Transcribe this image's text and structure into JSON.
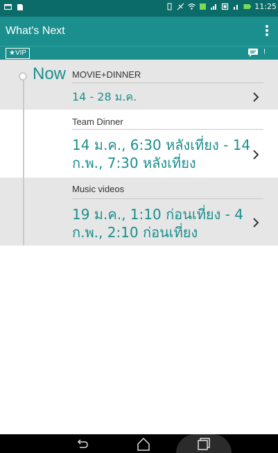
{
  "status_bar": {
    "time": "11:25"
  },
  "app_bar": {
    "title": "What's Next"
  },
  "vip_bar": {
    "badge": "★VIP",
    "alert": "!"
  },
  "timeline": {
    "now_label": "Now"
  },
  "events": [
    {
      "title": "MOVIE+DINNER",
      "date": "14 - 28 ม.ค."
    },
    {
      "title": "Team Dinner",
      "date": "14 ม.ค., 6:30 หลังเที่ยง - 14 ก.พ., 7:30 หลังเที่ยง"
    },
    {
      "title": "Music videos",
      "date": "19 ม.ค., 1:10 ก่อนเที่ยง - 4 ก.พ., 2:10 ก่อนเที่ยง"
    }
  ],
  "colors": {
    "accent": "#1b8f8d",
    "status_bar": "#0b6b68",
    "row_gray": "#e6e6e6"
  },
  "icons": {
    "status_left": [
      "screen-icon",
      "sd-card-icon"
    ],
    "status_right": [
      "vibrate-icon",
      "no-sim-icon",
      "wifi-icon",
      "data-icon",
      "signal-icon",
      "sim-icon",
      "signal2-icon",
      "battery-charging-icon"
    ],
    "nav": [
      "back-icon",
      "home-icon",
      "recents-icon"
    ]
  }
}
